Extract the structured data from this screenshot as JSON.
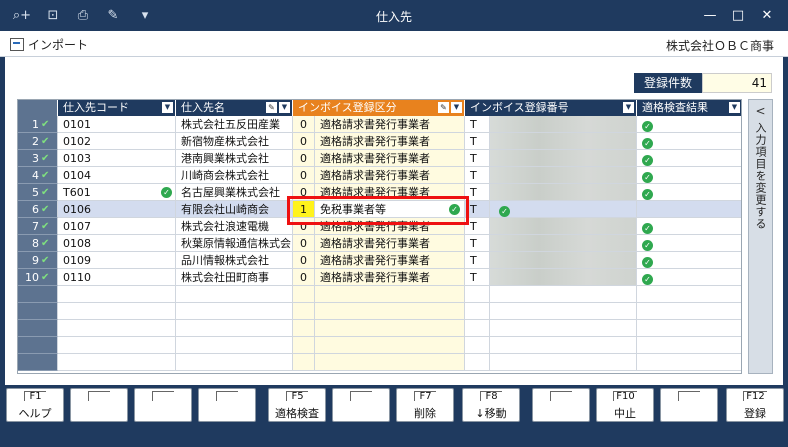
{
  "window": {
    "title": "仕入先",
    "toolbar_icons": [
      "search-plus-icon",
      "document-search-icon",
      "print-icon",
      "signature-icon",
      "dropdown-icon"
    ],
    "controls": [
      "minimize",
      "maximize",
      "close"
    ]
  },
  "menubar": {
    "import_label": "インポート",
    "company": "株式会社ＯＢＣ商事"
  },
  "count": {
    "label": "登録件数",
    "value": "41"
  },
  "columns": [
    "仕入先コード",
    "仕入先名",
    "インボイス登録区分",
    "インボイス登録番号",
    "適格検査結果"
  ],
  "rows": [
    {
      "no": "1",
      "code": "0101",
      "name": "株式会社五反田産業",
      "kbn_num": "0",
      "kbn_text": "適格請求書発行事業者",
      "reg": "T",
      "result": true
    },
    {
      "no": "2",
      "code": "0102",
      "name": "新宿物産株式会社",
      "kbn_num": "0",
      "kbn_text": "適格請求書発行事業者",
      "reg": "T",
      "result": true
    },
    {
      "no": "3",
      "code": "0103",
      "name": "港南興業株式会社",
      "kbn_num": "0",
      "kbn_text": "適格請求書発行事業者",
      "reg": "T",
      "result": true
    },
    {
      "no": "4",
      "code": "0104",
      "name": "川崎商会株式会社",
      "kbn_num": "0",
      "kbn_text": "適格請求書発行事業者",
      "reg": "T",
      "result": true
    },
    {
      "no": "5",
      "code": "T601",
      "name": "名古屋興業株式会社",
      "kbn_num": "0",
      "kbn_text": "適格請求書発行事業者",
      "reg": "T",
      "result": true
    },
    {
      "no": "6",
      "code": "0106",
      "name": "有限会社山崎商会",
      "kbn_num": "1",
      "kbn_text": "免税事業者等",
      "reg": "T",
      "result": false
    },
    {
      "no": "7",
      "code": "0107",
      "name": "株式会社浪速電機",
      "kbn_num": "0",
      "kbn_text": "適格請求書発行事業者",
      "reg": "T",
      "result": true
    },
    {
      "no": "8",
      "code": "0108",
      "name": "秋葉原情報通信株式会",
      "kbn_num": "0",
      "kbn_text": "適格請求書発行事業者",
      "reg": "T",
      "result": true
    },
    {
      "no": "9",
      "code": "0109",
      "name": "品川情報株式会社",
      "kbn_num": "0",
      "kbn_text": "適格請求書発行事業者",
      "reg": "T",
      "result": true
    },
    {
      "no": "10",
      "code": "0110",
      "name": "株式会社田町商事",
      "kbn_num": "0",
      "kbn_text": "適格請求書発行事業者",
      "reg": "T",
      "result": true
    }
  ],
  "side_panel": {
    "arrow": "<",
    "label": "入力項目を変更する"
  },
  "fkeys": [
    {
      "key": "F1",
      "label": "ヘルプ"
    },
    {
      "key": "",
      "label": ""
    },
    {
      "key": "",
      "label": ""
    },
    {
      "key": "",
      "label": ""
    },
    {
      "key": "F5",
      "label": "適格検査"
    },
    {
      "key": "",
      "label": ""
    },
    {
      "key": "F7",
      "label": "削除"
    },
    {
      "key": "F8",
      "label": "↓移動"
    },
    {
      "key": "",
      "label": ""
    },
    {
      "key": "F10",
      "label": "中止"
    },
    {
      "key": "",
      "label": ""
    },
    {
      "key": "F12",
      "label": "登録"
    }
  ],
  "colors": {
    "navy": "#1f3a5f",
    "orange": "#e8821e",
    "ok_green": "#2fa84f",
    "highlight_red": "#e11111"
  }
}
